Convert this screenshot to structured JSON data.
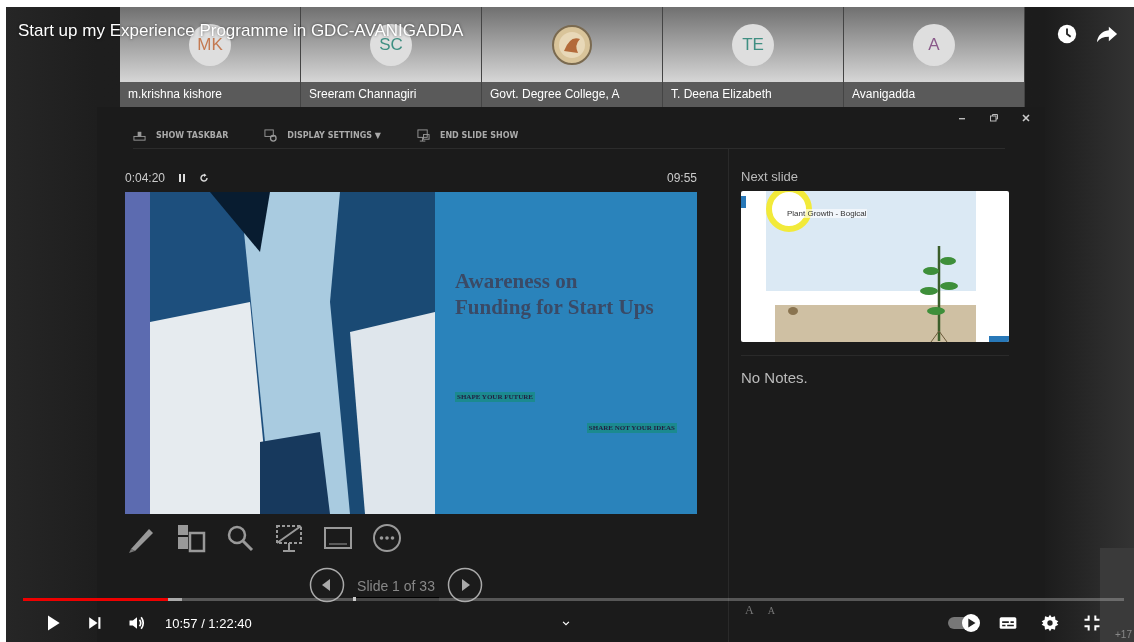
{
  "video": {
    "title": "Start up my Experience Programme in GDC-AVANIGADDA"
  },
  "participants": [
    {
      "kind": "initials",
      "initials": "MK",
      "color": "#c47a52",
      "name": "m.krishna kishore"
    },
    {
      "kind": "initials",
      "initials": "SC",
      "color": "#3f8f82",
      "name": "Sreeram Channagiri"
    },
    {
      "kind": "logo",
      "name": "Govt. Degree College, A"
    },
    {
      "kind": "initials",
      "initials": "TE",
      "color": "#3f8f82",
      "name": "T. Deena Elizabeth"
    },
    {
      "kind": "initials",
      "initials": "A",
      "color": "#8a5a8a",
      "name": "Avanigadda"
    }
  ],
  "overflow_count": "+17",
  "presenter": {
    "toolbar": [
      {
        "kind": "taskbar",
        "label": "SHOW TASKBAR"
      },
      {
        "kind": "display",
        "label": "DISPLAY SETTINGS ▼"
      },
      {
        "kind": "end",
        "label": "END SLIDE SHOW"
      }
    ],
    "elapsed": "0:04:20",
    "clock": "09:55",
    "slide": {
      "title": "Awareness on Funding for Start Ups",
      "lines": [
        "SHAPE YOUR FUTURE",
        "SHARE NOT YOUR IDEAS"
      ]
    },
    "slide_counter": "Slide 1 of 33",
    "slide_progress": {
      "level": 0.03
    },
    "next_slide_label": "Next slide",
    "next_slide_caption": "Plant Growth - Bogical",
    "notes": "No Notes.",
    "font_buttons": [
      "A",
      "A"
    ]
  },
  "player": {
    "progress": {
      "level": 0.132
    },
    "buffer": {
      "level": 0.144
    },
    "playing": false,
    "time": "10:57 / 1:22:40",
    "autoplay": {
      "on": true
    }
  }
}
